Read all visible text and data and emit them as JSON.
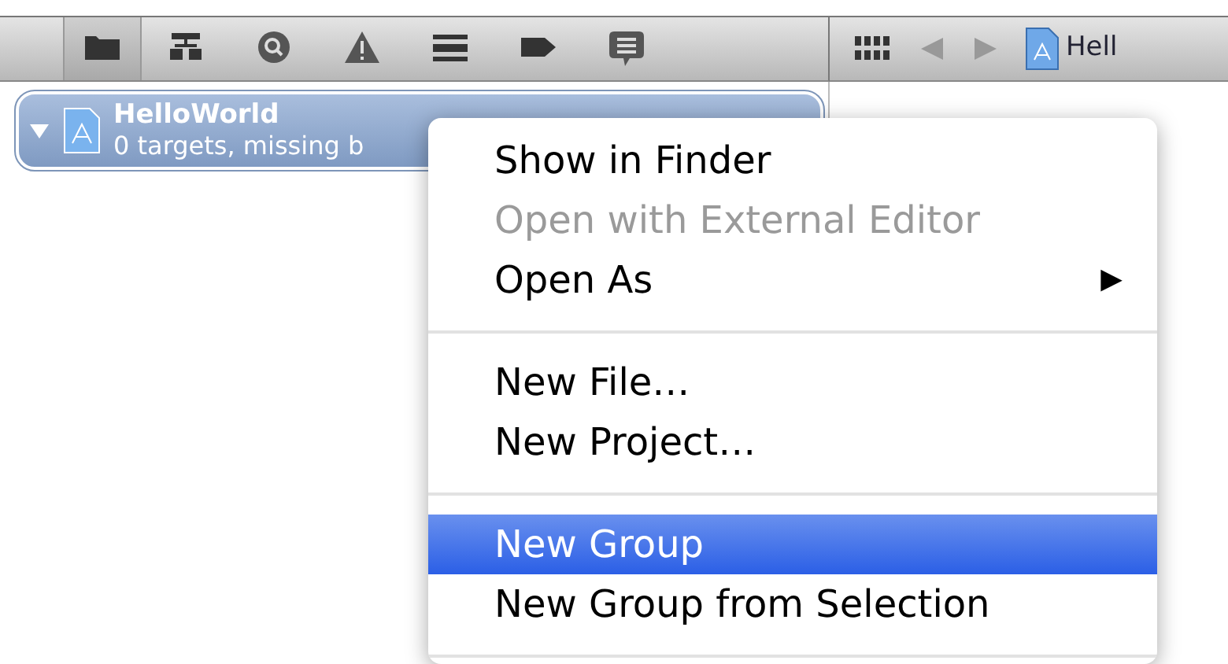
{
  "navigator_toolbar": {
    "icons": [
      {
        "kind": "folder",
        "selected": true
      },
      {
        "kind": "hierarchy",
        "selected": false
      },
      {
        "kind": "search",
        "selected": false
      },
      {
        "kind": "warning",
        "selected": false
      },
      {
        "kind": "list",
        "selected": false
      },
      {
        "kind": "tag",
        "selected": false
      },
      {
        "kind": "speech",
        "selected": false
      }
    ]
  },
  "editor_toolbar": {
    "breadcrumb": "Hell"
  },
  "project": {
    "name": "HelloWorld",
    "subtitle": "0 targets, missing b",
    "expanded": true,
    "selected": true
  },
  "context_menu": {
    "items": [
      {
        "kind": "item",
        "label": "Show in Finder",
        "disabled": false,
        "selected": false
      },
      {
        "kind": "item",
        "label": "Open with External Editor",
        "disabled": true,
        "selected": false
      },
      {
        "kind": "item",
        "label": "Open As",
        "disabled": false,
        "selected": false,
        "arrow": "▶"
      },
      {
        "kind": "separator"
      },
      {
        "kind": "item",
        "label": "New File…",
        "disabled": false,
        "selected": false
      },
      {
        "kind": "item",
        "label": "New Project…",
        "disabled": false,
        "selected": false
      },
      {
        "kind": "separator"
      },
      {
        "kind": "item",
        "label": "New Group",
        "disabled": false,
        "selected": true
      },
      {
        "kind": "item",
        "label": "New Group from Selection",
        "disabled": false,
        "selected": false
      },
      {
        "kind": "separator"
      }
    ]
  }
}
